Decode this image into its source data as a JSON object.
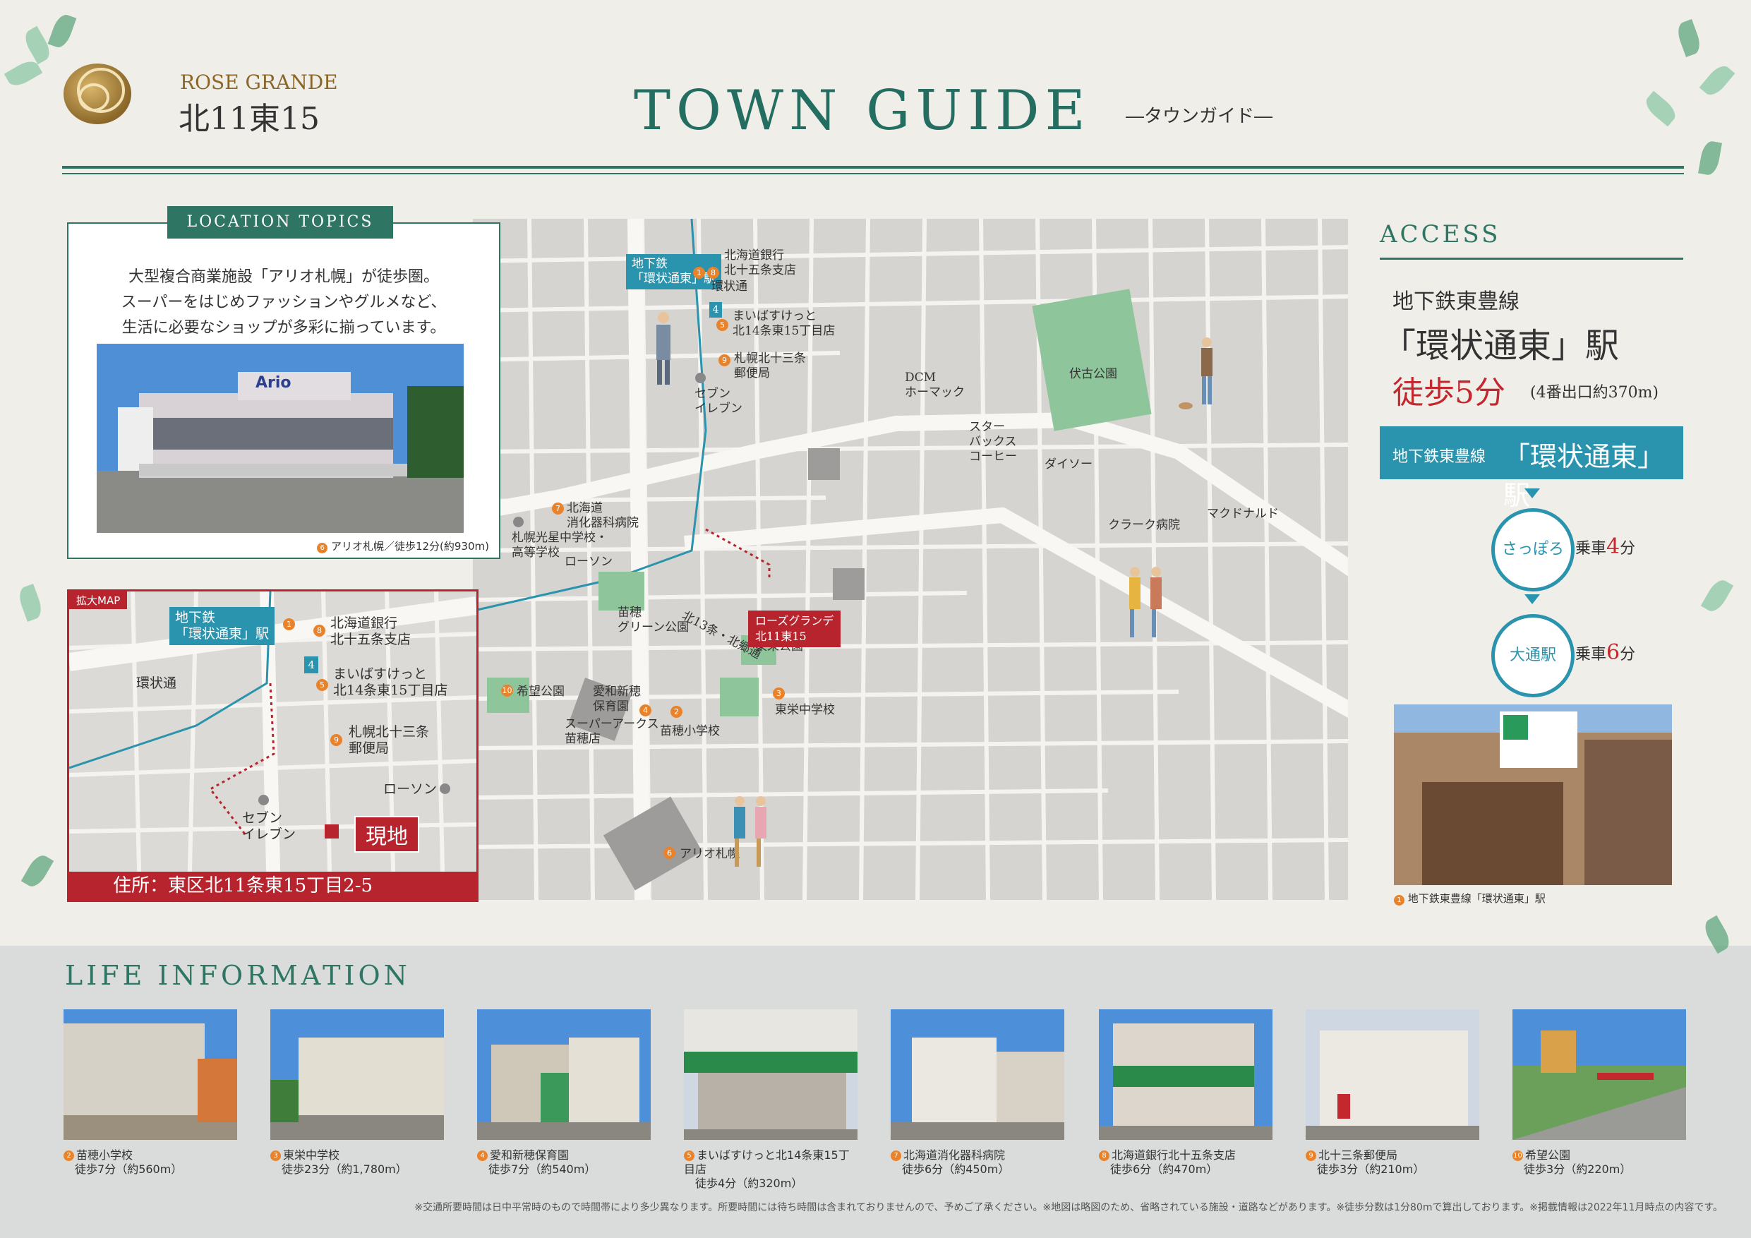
{
  "brand": {
    "name": "ROSE GRANDE",
    "property": "北11東15"
  },
  "header": {
    "title": "TOWN GUIDE",
    "subtitle": "―タウンガイド―"
  },
  "topics": {
    "label": "LOCATION TOPICS",
    "text": "大型複合商業施設「アリオ札幌」が徒歩圏。\nスーパーをはじめファッションやグルメなど、\n生活に必要なショップが多彩に揃っています。",
    "caption_num": "6",
    "caption": "アリオ札幌／徒歩12分(約930m)",
    "photo_sign": "Ario"
  },
  "map": {
    "station": "地下鉄\n「環状通東」駅",
    "labels": {
      "bank": "北海道銀行\n北十五条支店",
      "kanjo": "環状通",
      "mybasket": "まいばすけっと\n北14条東15丁目店",
      "post": "札幌北十三条\n郵便局",
      "seven": "セブン\nイレブン",
      "koseijh": "札幌光星中学校・\n高等学校",
      "dcm": "DCM\nホーマック",
      "starbucks": "スター\nバックス\nコーヒー",
      "fushiko": "伏古公園",
      "daiso": "ダイソー",
      "mcd": "マクドナルド",
      "clark": "クラーク病院",
      "digestive": "北海道\n消化器科病院",
      "lawson": "ローソン",
      "naebopark": "苗穂\nグリーン公園",
      "kita13": "北13条・北郷通",
      "toeipark": "東栄公園",
      "toeijh": "東栄中学校",
      "kibou": "希望公園",
      "arcs": "スーパーアークス\n苗穂店",
      "aiwa": "愛和新穂\n保育園",
      "naeboes": "苗穂小学校",
      "ario": "アリオ札幌",
      "site": "ローズグランデ\n北11東15",
      "exit": "4"
    }
  },
  "small_map": {
    "tag": "拡大MAP",
    "station": "地下鉄\n「環状通東」駅",
    "bank": "北海道銀行\n北十五条支店",
    "mybasket": "まいばすけっと\n北14条東15丁目店",
    "post": "札幌北十三条\n郵便局",
    "lawson": "ローソン",
    "seven": "セブン\nイレブン",
    "kanjo": "環状通",
    "site": "現地",
    "exit": "4",
    "address": "住所：東区北11条東15丁目2-5"
  },
  "access": {
    "title": "ACCESS",
    "line": "地下鉄東豊線",
    "station": "「環状通東」駅",
    "walk": "徒歩5分",
    "walk_note": "(4番出口約370m)",
    "box_line": "地下鉄東豊線",
    "box_station": "「環状通東」駅",
    "route": [
      {
        "station": "さっぽろ",
        "ride": "乗車",
        "min": "4",
        "unit": "分"
      },
      {
        "station": "大通駅",
        "ride": "乗車",
        "min": "6",
        "unit": "分"
      }
    ],
    "caption_num": "1",
    "caption": "地下鉄東豊線「環状通東」駅"
  },
  "life": {
    "title": "LIFE INFORMATION",
    "items": [
      {
        "num": "2",
        "name": "苗穂小学校",
        "walk": "徒歩7分（約560m）"
      },
      {
        "num": "3",
        "name": "東栄中学校",
        "walk": "徒歩23分（約1,780m）"
      },
      {
        "num": "4",
        "name": "愛和新穂保育園",
        "walk": "徒歩7分（約540m）"
      },
      {
        "num": "5",
        "name": "まいばすけっと北14条東15丁目店",
        "walk": "徒歩4分（約320m）"
      },
      {
        "num": "7",
        "name": "北海道消化器科病院",
        "walk": "徒歩6分（約450m）"
      },
      {
        "num": "8",
        "name": "北海道銀行北十五条支店",
        "walk": "徒歩6分（約470m）"
      },
      {
        "num": "9",
        "name": "北十三条郵便局",
        "walk": "徒歩3分（約210m）"
      },
      {
        "num": "10",
        "name": "希望公園",
        "walk": "徒歩3分（約220m）"
      }
    ]
  },
  "note": "※交通所要時間は日中平常時のもので時間帯により多少異なります。所要時間には待ち時間は含まれておりませんので、予めご了承ください。※地図は略図のため、省略されている施設・道路などがあります。※徒歩分数は1分80mで算出しております。※掲載情報は2022年11月時点の内容です。",
  "colors": {
    "teal": "#2e7564",
    "blue": "#2a93ad",
    "red": "#b8242e",
    "orange": "#e8822b"
  }
}
